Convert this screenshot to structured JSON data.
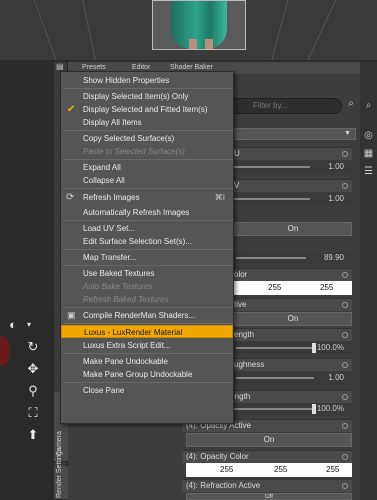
{
  "menu": {
    "items": [
      {
        "label": "Show Hidden Properties"
      },
      {
        "label": "Display Selected Item(s) Only"
      },
      {
        "label": "Display Selected and Fitted Item(s)"
      },
      {
        "label": "Display All Items"
      },
      {
        "label": "Copy Selected Surface(s)"
      },
      {
        "label": "Paste to Selected Surface(s)"
      },
      {
        "label": "Expand All"
      },
      {
        "label": "Collapse All"
      },
      {
        "label": "Refresh Images",
        "shortcut": "⌘I"
      },
      {
        "label": "Automatically Refresh Images"
      },
      {
        "label": "Load UV Set..."
      },
      {
        "label": "Edit Surface Selection Set(s)..."
      },
      {
        "label": "Map Transfer..."
      },
      {
        "label": "Use Baked Textures"
      },
      {
        "label": "Auto Bake Textures"
      },
      {
        "label": "Refresh Baked Textures"
      },
      {
        "label": "Compile RenderMan Shaders..."
      },
      {
        "label": "Luxus - LuxRender Material"
      },
      {
        "label": "Luxus Extra Script Edit..."
      },
      {
        "label": "Make Pane Undockable"
      },
      {
        "label": "Make Pane Group Undockable"
      },
      {
        "label": "Close Pane"
      }
    ]
  },
  "panel": {
    "tabs": [
      "Presets",
      "Editor",
      "Shader Baker"
    ],
    "search_placeholder": "Filter by...",
    "side_tabs": [
      "Camera",
      "Render Settings"
    ],
    "props": {
      "u_label": "U",
      "u_value": "1.00",
      "v_label": "V",
      "v_value": "1.00",
      "on1": "On",
      "angle_value": "89.90",
      "color1_label": "olor",
      "color1_g": "255",
      "color1_b": "255",
      "active_label": "tive",
      "on2": "On",
      "strength_label": "ength",
      "strength_value": "100.0%",
      "roughness_label": "ughness",
      "roughness_value": "1.00",
      "strength2_label": "Strength",
      "strength2_value": "100.0%",
      "opacity_active_label": "(4): Opacity Active",
      "on3": "On",
      "opacity_color_label": "(4): Opacity Color",
      "opacity_r": "255",
      "opacity_g": "255",
      "opacity_b": "255",
      "refraction_active_label": "(4): Refraction Active",
      "off": "Off"
    }
  },
  "colors": {
    "highlight": "#f0a800",
    "menu_bg": "#555555",
    "check": "#f0b400"
  }
}
